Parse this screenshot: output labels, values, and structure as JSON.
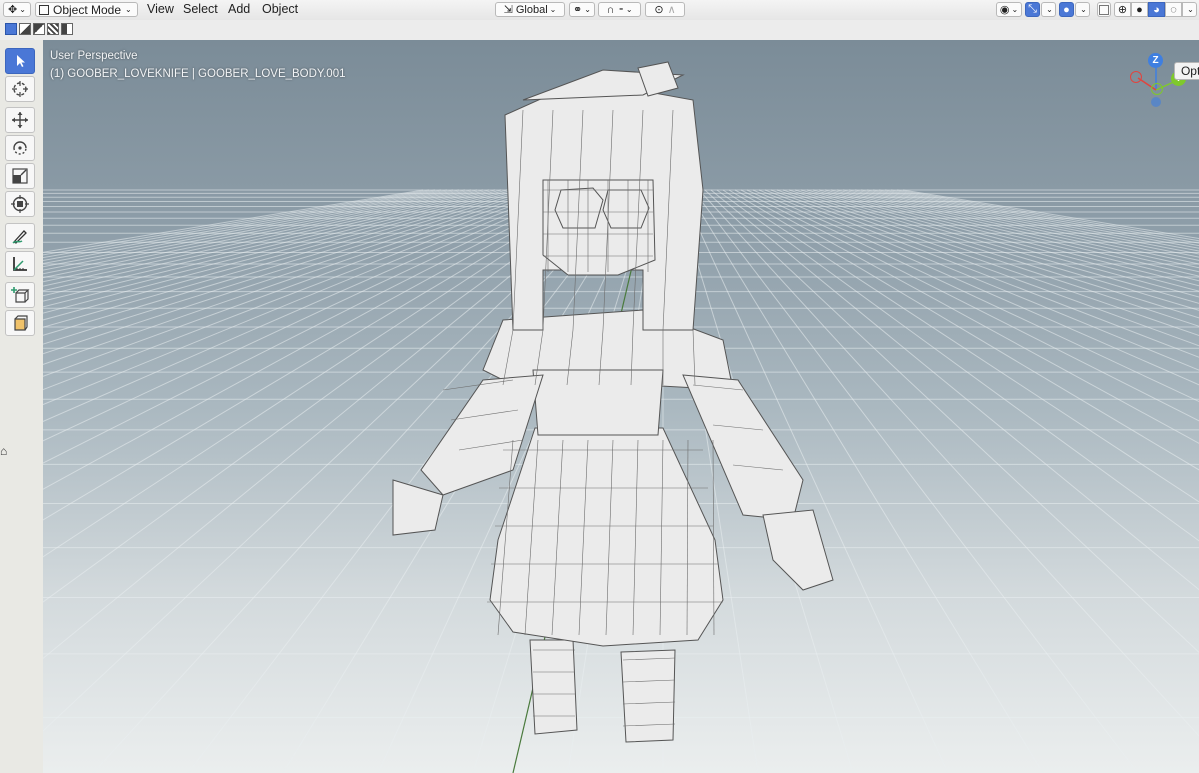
{
  "header": {
    "mode_label": "Object Mode",
    "menus": [
      "View",
      "Select",
      "Add",
      "Object"
    ],
    "transform_orientation": "Global"
  },
  "viewport": {
    "perspective_label": "User Perspective",
    "object_label": "(1) GOOBER_LOVEKNIFE | GOOBER_LOVE_BODY.001",
    "options_label": "Options"
  },
  "gizmo": {
    "x": "X",
    "y": "Y",
    "z": "Z"
  },
  "colors": {
    "accent": "#4a77d6",
    "axis_x": "#e0453f",
    "axis_y": "#7fc92b",
    "axis_z": "#3f7fe0",
    "grid_y_line": "#4a7a3d"
  },
  "toolbar": {
    "tools": [
      "select-tool",
      "cursor-tool",
      "move-tool",
      "rotate-tool",
      "scale-tool",
      "transform-tool",
      "annotate-tool",
      "measure-tool",
      "add-cube-tool",
      "add-object-tool"
    ]
  }
}
